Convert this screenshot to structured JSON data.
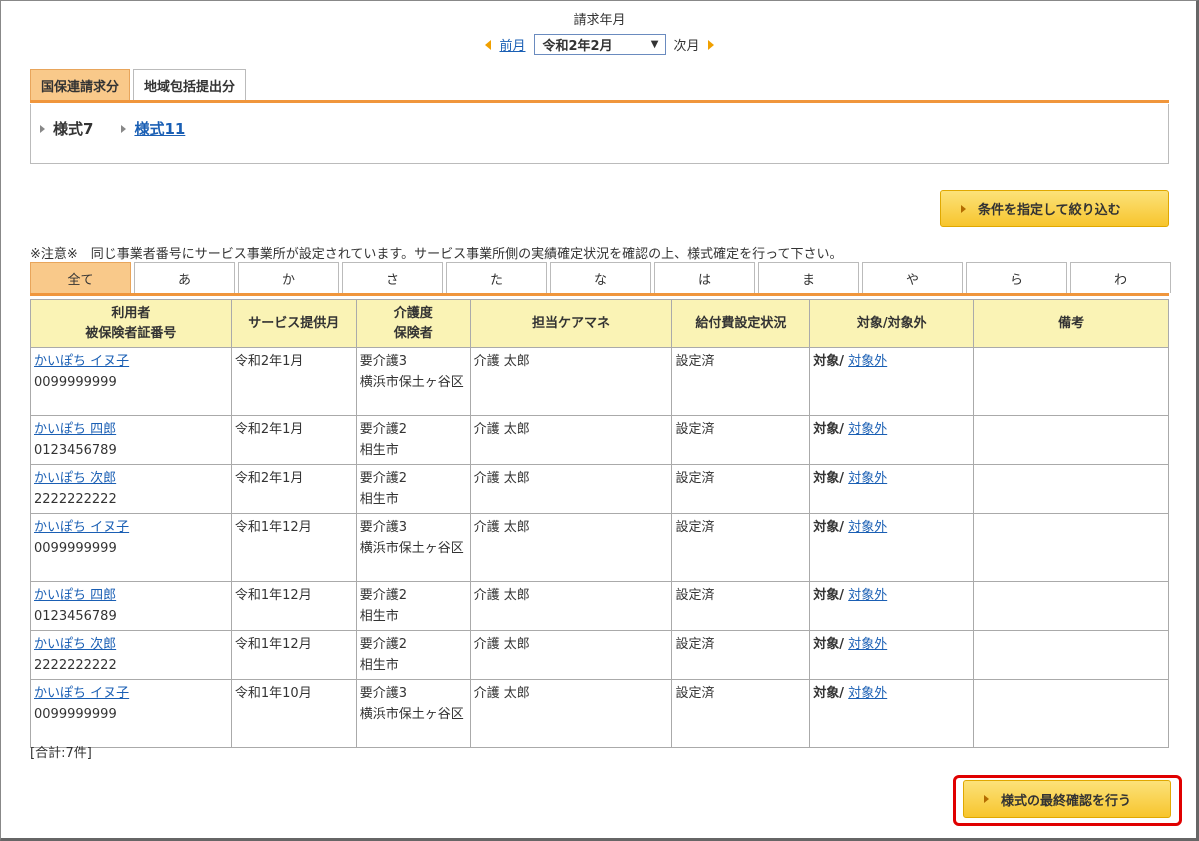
{
  "header": {
    "title": "請求年月",
    "prev_label": "前月",
    "selected_month": "令和2年2月",
    "next_label": "次月"
  },
  "top_tabs": [
    {
      "label": "国保連請求分",
      "active": true
    },
    {
      "label": "地域包括提出分",
      "active": false
    }
  ],
  "forms": {
    "form7": "様式7",
    "form11": "様式11"
  },
  "filter_button": "条件を指定して絞り込む",
  "notice": "※注意※　同じ事業者番号にサービス事業所が設定されています。サービス事業所側の実績確定状況を確認の上、様式確定を行って下さい。",
  "kana_tabs": [
    "全て",
    "あ",
    "か",
    "さ",
    "た",
    "な",
    "は",
    "ま",
    "や",
    "ら",
    "わ"
  ],
  "table": {
    "headers": {
      "user_line1": "利用者",
      "user_line2": "被保険者証番号",
      "service_month": "サービス提供月",
      "care_line1": "介護度",
      "care_line2": "保険者",
      "manager": "担当ケアマネ",
      "benefit_status": "給付費設定状況",
      "target": "対象/対象外",
      "remarks": "備考"
    },
    "rows": [
      {
        "name": "かいぽち イヌ子",
        "number": "0099999999",
        "month": "令和2年1月",
        "care_level": "要介護3",
        "insurer": "横浜市保土ヶ谷区",
        "manager": "介護 太郎",
        "status": "設定済",
        "target": "対象/",
        "excluded": "対象外",
        "remarks": ""
      },
      {
        "name": "かいぽち 四郎",
        "number": "0123456789",
        "month": "令和2年1月",
        "care_level": "要介護2",
        "insurer": "相生市",
        "manager": "介護 太郎",
        "status": "設定済",
        "target": "対象/",
        "excluded": "対象外",
        "remarks": ""
      },
      {
        "name": "かいぽち 次郎",
        "number": "2222222222",
        "month": "令和2年1月",
        "care_level": "要介護2",
        "insurer": "相生市",
        "manager": "介護 太郎",
        "status": "設定済",
        "target": "対象/",
        "excluded": "対象外",
        "remarks": ""
      },
      {
        "name": "かいぽち イヌ子",
        "number": "0099999999",
        "month": "令和1年12月",
        "care_level": "要介護3",
        "insurer": "横浜市保土ヶ谷区",
        "manager": "介護 太郎",
        "status": "設定済",
        "target": "対象/",
        "excluded": "対象外",
        "remarks": ""
      },
      {
        "name": "かいぽち 四郎",
        "number": "0123456789",
        "month": "令和1年12月",
        "care_level": "要介護2",
        "insurer": "相生市",
        "manager": "介護 太郎",
        "status": "設定済",
        "target": "対象/",
        "excluded": "対象外",
        "remarks": ""
      },
      {
        "name": "かいぽち 次郎",
        "number": "2222222222",
        "month": "令和1年12月",
        "care_level": "要介護2",
        "insurer": "相生市",
        "manager": "介護 太郎",
        "status": "設定済",
        "target": "対象/",
        "excluded": "対象外",
        "remarks": ""
      },
      {
        "name": "かいぽち イヌ子",
        "number": "0099999999",
        "month": "令和1年10月",
        "care_level": "要介護3",
        "insurer": "横浜市保土ヶ谷区",
        "manager": "介護 太郎",
        "status": "設定済",
        "target": "対象/",
        "excluded": "対象外",
        "remarks": ""
      }
    ]
  },
  "total": "[合計:7件]",
  "confirm_button": "様式の最終確認を行う"
}
